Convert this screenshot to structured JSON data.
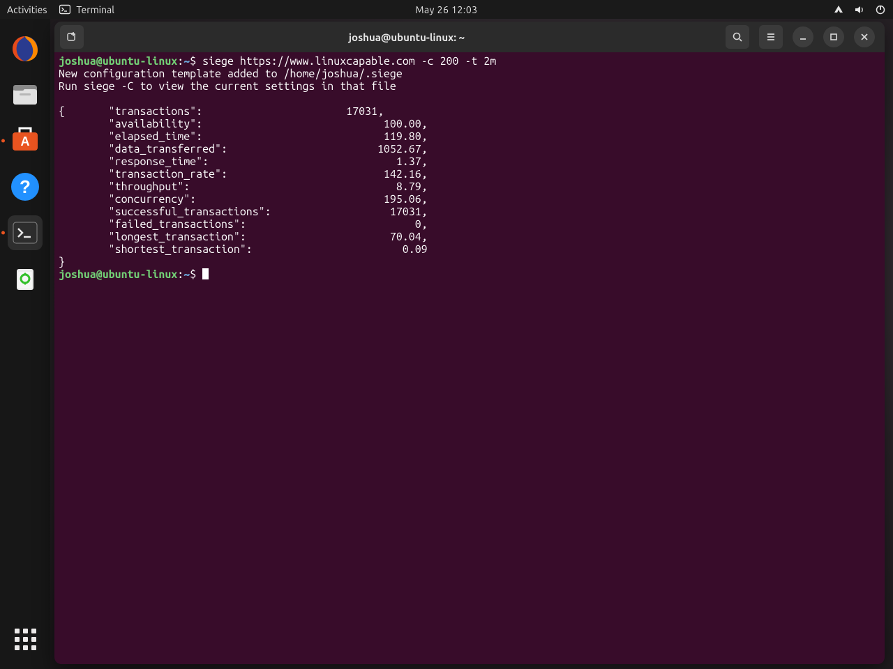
{
  "topbar": {
    "activities": "Activities",
    "app_label": "Terminal",
    "clock": "May 26  12:03"
  },
  "dock": {
    "items": [
      {
        "name": "firefox"
      },
      {
        "name": "files"
      },
      {
        "name": "software"
      },
      {
        "name": "help"
      },
      {
        "name": "terminal",
        "active": true
      },
      {
        "name": "trash"
      }
    ]
  },
  "window": {
    "title": "joshua@ubuntu-linux: ~"
  },
  "terminal": {
    "prompt_userhost": "joshua@ubuntu-linux",
    "prompt_sep": ":",
    "prompt_path": "~",
    "prompt_symbol": "$",
    "command": "siege https://www.linuxcapable.com -c 200 -t 2m",
    "preamble": [
      "New configuration template added to /home/joshua/.siege",
      "Run siege -C to view the current settings in that file",
      ""
    ],
    "result_open": "{       \"transactions\":                       17031,",
    "results": [
      {
        "key": "availability",
        "val": "100.00,"
      },
      {
        "key": "elapsed_time",
        "val": "119.80,"
      },
      {
        "key": "data_transferred",
        "val": "1052.67,"
      },
      {
        "key": "response_time",
        "val": "1.37,"
      },
      {
        "key": "transaction_rate",
        "val": "142.16,"
      },
      {
        "key": "throughput",
        "val": "8.79,"
      },
      {
        "key": "concurrency",
        "val": "195.06,"
      },
      {
        "key": "successful_transactions",
        "val": "17031,"
      },
      {
        "key": "failed_transactions",
        "val": "0,"
      },
      {
        "key": "longest_transaction",
        "val": "70.04,"
      },
      {
        "key": "shortest_transaction",
        "val": "0.09"
      }
    ],
    "result_close": "}"
  }
}
